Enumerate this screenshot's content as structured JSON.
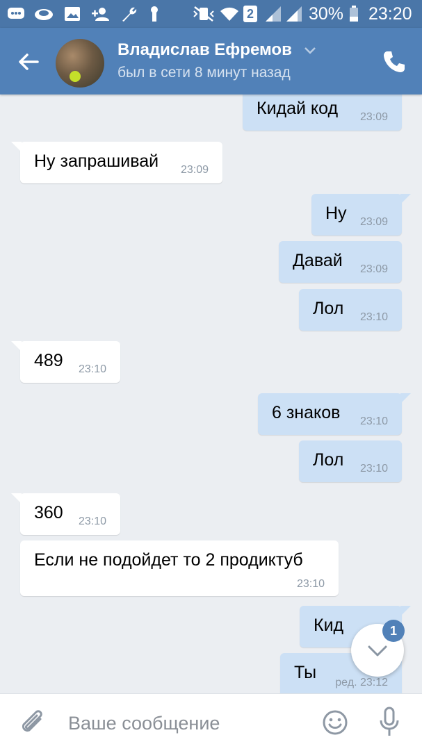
{
  "status_bar": {
    "battery": "30%",
    "time": "23:20",
    "sim": "2"
  },
  "header": {
    "name": "Владислав Ефремов",
    "status": "был в сети 8 минут назад"
  },
  "messages": [
    {
      "direction": "out",
      "text": "Кидай код",
      "time": "23:09"
    },
    {
      "direction": "in",
      "text": "Ну запрашивай",
      "time": "23:09"
    },
    {
      "direction": "out",
      "text": "Ну",
      "time": "23:09"
    },
    {
      "direction": "out",
      "text": "Давай",
      "time": "23:09"
    },
    {
      "direction": "out",
      "text": "Лол",
      "time": "23:10"
    },
    {
      "direction": "in",
      "text": "489",
      "time": "23:10"
    },
    {
      "direction": "out",
      "text": "6 знаков",
      "time": "23:10"
    },
    {
      "direction": "out",
      "text": "Лол",
      "time": "23:10"
    },
    {
      "direction": "in",
      "text": "360",
      "time": "23:10"
    },
    {
      "direction": "in",
      "text": "Если не подойдет то 2 продиктуб",
      "time": "23:10"
    },
    {
      "direction": "out",
      "text": "Кид",
      "time": ""
    },
    {
      "direction": "out",
      "text": "Ты",
      "time": "ред. 23:12"
    }
  ],
  "scroll_down": {
    "badge": "1"
  },
  "composer": {
    "placeholder": "Ваше сообщение"
  },
  "colors": {
    "header": "#5181b8",
    "status_bar": "#4a76a8",
    "chat_bg": "#ebeef2",
    "outgoing_bubble": "#cce0f5",
    "incoming_bubble": "#ffffff"
  }
}
